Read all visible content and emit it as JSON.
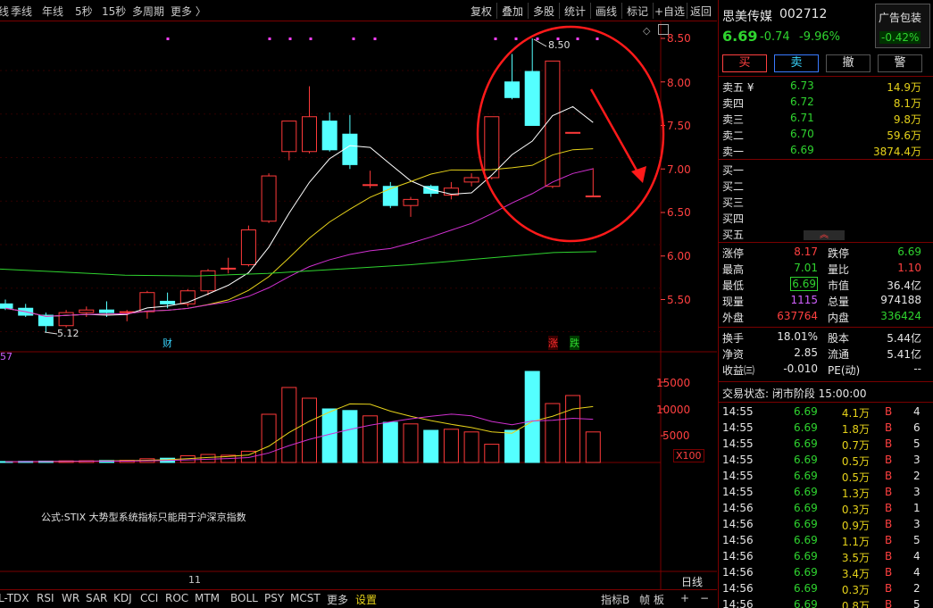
{
  "toolbar": {
    "left_items": [
      "线",
      "季线",
      "年线",
      "5秒",
      "15秒",
      "多周期",
      "更多 〉"
    ],
    "right_items": [
      "复权",
      "叠加",
      "多股",
      "统计",
      "画线",
      "标记",
      "+自选",
      "返回"
    ]
  },
  "chart": {
    "price_axis": [
      "8.50",
      "8.00",
      "7.50",
      "7.00",
      "6.50",
      "6.00",
      "5.50"
    ],
    "volume_axis": [
      "15000",
      "10000",
      "5000"
    ],
    "volume_unit": "X100",
    "high_label": "8.50",
    "low_label": "5.12",
    "left_label": "57",
    "marker_cai": "财",
    "marker_zhang": "涨",
    "marker_die": "跌",
    "formula_text": "公式:STIX 大势型系统指标只能用于沪深京指数",
    "date_label": "11",
    "period_label": "日线"
  },
  "chart_data": {
    "type": "candlestick",
    "ohlc": [
      [
        5.45,
        5.5,
        5.38,
        5.4
      ],
      [
        5.4,
        5.45,
        5.3,
        5.32
      ],
      [
        5.32,
        5.35,
        5.12,
        5.2
      ],
      [
        5.2,
        5.38,
        5.18,
        5.35
      ],
      [
        5.35,
        5.42,
        5.3,
        5.38
      ],
      [
        5.38,
        5.48,
        5.3,
        5.35
      ],
      [
        5.35,
        5.38,
        5.25,
        5.36
      ],
      [
        5.36,
        5.6,
        5.28,
        5.58
      ],
      [
        5.48,
        5.58,
        5.4,
        5.45
      ],
      [
        5.45,
        5.62,
        5.42,
        5.6
      ],
      [
        5.6,
        5.85,
        5.55,
        5.83
      ],
      [
        5.85,
        5.98,
        5.8,
        5.86
      ],
      [
        5.9,
        6.35,
        5.88,
        6.3
      ],
      [
        6.4,
        6.95,
        6.38,
        6.92
      ],
      [
        7.2,
        7.55,
        7.1,
        7.55
      ],
      [
        7.2,
        7.95,
        7.18,
        7.6
      ],
      [
        7.55,
        7.65,
        7.2,
        7.22
      ],
      [
        7.4,
        7.62,
        7.0,
        7.05
      ],
      [
        6.82,
        6.98,
        6.78,
        6.82
      ],
      [
        6.8,
        6.85,
        6.55,
        6.58
      ],
      [
        6.58,
        6.68,
        6.45,
        6.65
      ],
      [
        6.8,
        6.82,
        6.68,
        6.72
      ],
      [
        6.7,
        6.85,
        6.65,
        6.78
      ],
      [
        6.85,
        6.95,
        6.8,
        6.9
      ],
      [
        6.9,
        7.6,
        6.88,
        7.6
      ],
      [
        8.0,
        8.32,
        7.8,
        7.82
      ],
      [
        8.12,
        8.5,
        7.5,
        7.5
      ],
      [
        6.8,
        8.24,
        6.78,
        8.24
      ],
      [
        7.42,
        7.42,
        7.42,
        7.42
      ],
      [
        6.69,
        7.01,
        6.69,
        6.69
      ]
    ],
    "volume": [
      120,
      150,
      180,
      220,
      260,
      300,
      320,
      380,
      400,
      700,
      800,
      1250,
      1500,
      1350,
      2100,
      9000,
      14000,
      12000,
      10000,
      9700,
      8700,
      7500,
      7200,
      6000,
      6200,
      5700,
      3400,
      6000,
      17000,
      11000,
      12500,
      5700
    ],
    "ma_lines": [
      "white",
      "yellow",
      "magenta",
      "green"
    ]
  },
  "stock": {
    "name": "思美传媒",
    "code": "002712",
    "price": "6.69",
    "change": "-0.74",
    "change_pct": "-9.96%",
    "ad_label": "广告包装",
    "ad_pct": "-0.42%"
  },
  "trade_buttons": [
    "买",
    "卖",
    "撤",
    "警"
  ],
  "order_book": {
    "sells": [
      {
        "label": "卖五 ¥",
        "price": "6.73",
        "vol": "14.9万"
      },
      {
        "label": "卖四",
        "price": "6.72",
        "vol": "8.1万"
      },
      {
        "label": "卖三",
        "price": "6.71",
        "vol": "9.8万"
      },
      {
        "label": "卖二",
        "price": "6.70",
        "vol": "59.6万"
      },
      {
        "label": "卖一",
        "price": "6.69",
        "vol": "3874.4万"
      }
    ],
    "buys": [
      "买一",
      "买二",
      "买三",
      "买四",
      "买五"
    ]
  },
  "stats": [
    {
      "l1": "涨停",
      "v1": "8.17",
      "l2": "跌停",
      "v2": "6.69"
    },
    {
      "l1": "最高",
      "v1": "7.01",
      "l2": "量比",
      "v2": "1.10"
    },
    {
      "l1": "最低",
      "v1": "6.69",
      "l2": "市值",
      "v2": "36.4亿"
    },
    {
      "l1": "现量",
      "v1": "1115",
      "l2": "总量",
      "v2": "974188"
    },
    {
      "l1": "外盘",
      "v1": "637764",
      "l2": "内盘",
      "v2": "336424"
    },
    {
      "l1": "换手",
      "v1": "18.01%",
      "l2": "股本",
      "v2": "5.44亿"
    },
    {
      "l1": "净资",
      "v1": "2.85",
      "l2": "流通",
      "v2": "5.41亿"
    },
    {
      "l1": "收益㈢",
      "v1": "-0.010",
      "l2": "PE(动)",
      "v2": "--"
    }
  ],
  "status": "交易状态: 闭市阶段 15:00:00",
  "ticks": [
    {
      "t": "14:55",
      "p": "6.69",
      "v": "4.1万",
      "s": "B",
      "n": "4"
    },
    {
      "t": "14:55",
      "p": "6.69",
      "v": "1.8万",
      "s": "B",
      "n": "6"
    },
    {
      "t": "14:55",
      "p": "6.69",
      "v": "0.7万",
      "s": "B",
      "n": "5"
    },
    {
      "t": "14:55",
      "p": "6.69",
      "v": "0.5万",
      "s": "B",
      "n": "3"
    },
    {
      "t": "14:55",
      "p": "6.69",
      "v": "0.5万",
      "s": "B",
      "n": "2"
    },
    {
      "t": "14:55",
      "p": "6.69",
      "v": "1.3万",
      "s": "B",
      "n": "3"
    },
    {
      "t": "14:56",
      "p": "6.69",
      "v": "0.3万",
      "s": "B",
      "n": "1"
    },
    {
      "t": "14:56",
      "p": "6.69",
      "v": "0.9万",
      "s": "B",
      "n": "3"
    },
    {
      "t": "14:56",
      "p": "6.69",
      "v": "1.1万",
      "s": "B",
      "n": "5"
    },
    {
      "t": "14:56",
      "p": "6.69",
      "v": "3.5万",
      "s": "B",
      "n": "4"
    },
    {
      "t": "14:56",
      "p": "6.69",
      "v": "3.4万",
      "s": "B",
      "n": "4"
    },
    {
      "t": "14:56",
      "p": "6.69",
      "v": "0.3万",
      "s": "B",
      "n": "2"
    },
    {
      "t": "14:56",
      "p": "6.69",
      "v": "0.8万",
      "s": "B",
      "n": "5"
    }
  ],
  "bottom": {
    "indicators": [
      "L-TDX",
      "RSI",
      "WR",
      "SAR",
      "KDJ",
      "CCI",
      "ROC",
      "MTM",
      "BOLL",
      "PSY",
      "MCST",
      "更多",
      "设置"
    ],
    "right_items": [
      "指标B",
      "帧",
      "板"
    ]
  }
}
